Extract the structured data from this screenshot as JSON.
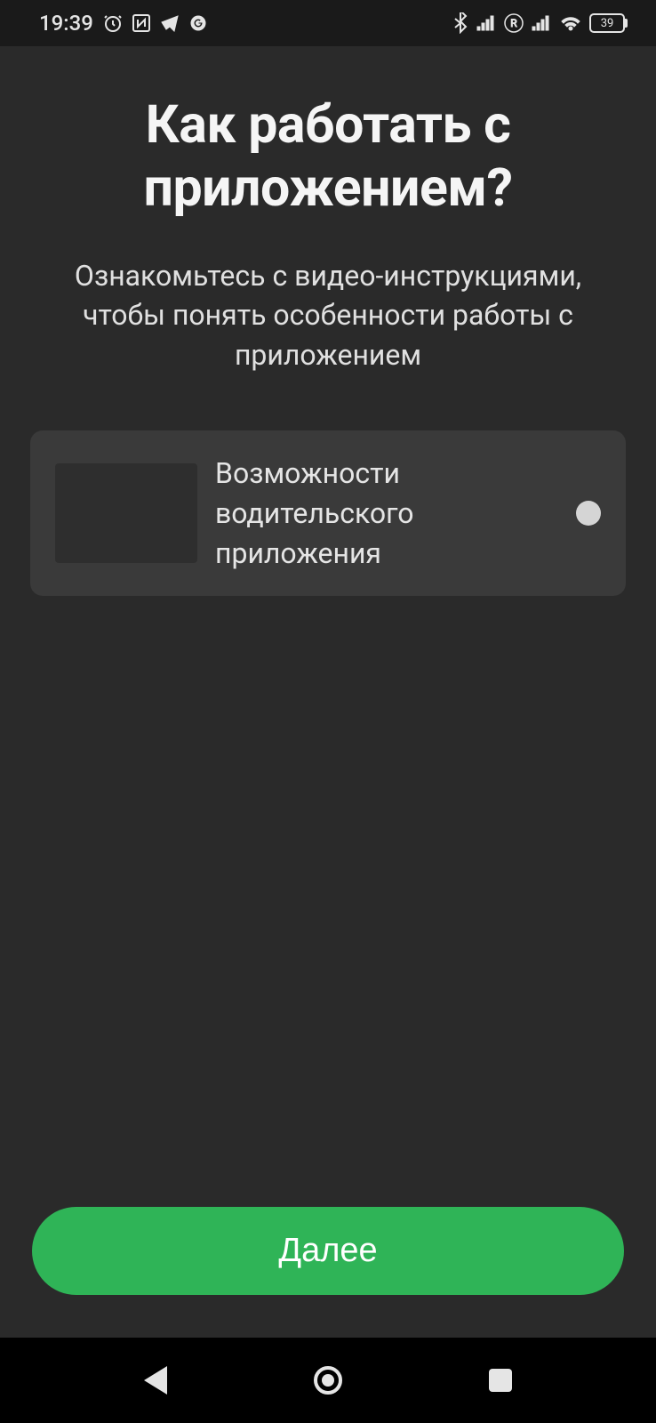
{
  "status_bar": {
    "time": "19:39",
    "battery_percent": "39"
  },
  "main": {
    "title": "Как работать с приложением?",
    "subtitle": "Ознакомьтесь с видео-инструкциями, чтобы понять особенности работы с приложением",
    "video_item": {
      "title": "Возможности водительского приложения"
    },
    "next_button_label": "Далее"
  }
}
